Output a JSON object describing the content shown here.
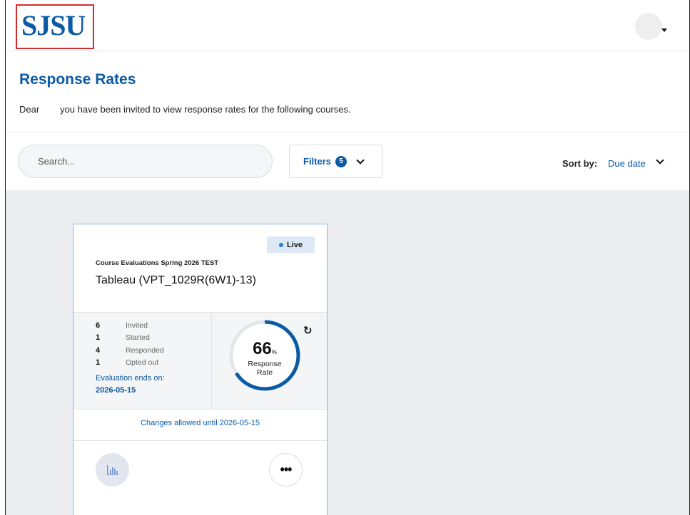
{
  "header": {
    "logo_text": "SJSU"
  },
  "page": {
    "title": "Response Rates",
    "greeting": "Dear        you have been invited to view response rates for the following courses."
  },
  "toolbar": {
    "search_placeholder": "Search...",
    "filters_label": "Filters",
    "filters_count": "5",
    "sort_label": "Sort by:",
    "sort_value": "Due date"
  },
  "card": {
    "status": "Live",
    "program": "Course Evaluations Spring 2026 TEST",
    "course": "Tableau (VPT_1029R(6W1)-13)",
    "stats": [
      {
        "value": "6",
        "label": "Invited"
      },
      {
        "value": "1",
        "label": "Started"
      },
      {
        "value": "4",
        "label": "Responded"
      },
      {
        "value": "1",
        "label": "Opted out"
      }
    ],
    "eval_ends_label": "Evaluation ends on:",
    "eval_ends_date": "2026-05-15",
    "response_rate": "66",
    "response_rate_unit": "%",
    "response_rate_fraction": 0.66,
    "response_label_line1": "Response",
    "response_label_line2": "Rate",
    "changes_text": "Changes allowed until 2026-05-15"
  },
  "colors": {
    "brand": "#0b5aa6",
    "live_dot": "#2a7fd4",
    "content_bg": "#ebedf0",
    "highlight_border": "#d42a2a"
  },
  "icons": {
    "avatar": "user-avatar",
    "filters_chevron": "chevron-down-icon",
    "sort_chevron": "chevron-down-icon",
    "refresh": "refresh-icon",
    "report": "bar-chart-icon",
    "more": "more-options-icon"
  }
}
